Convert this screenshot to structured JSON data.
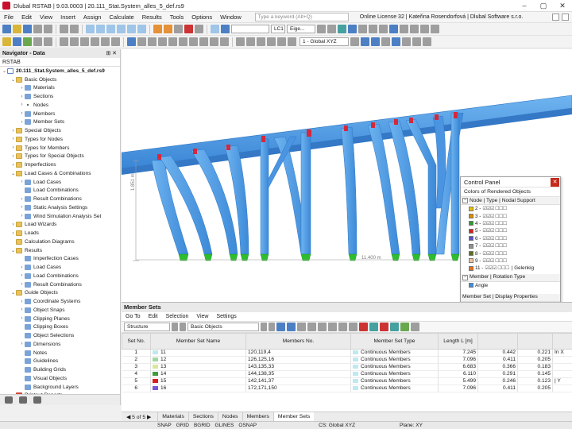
{
  "window": {
    "title": "Dlubal RSTAB | 9.03.0003 | 20.111_Stat.System_alles_5_def.rs9"
  },
  "menu": {
    "items": [
      "File",
      "Edit",
      "View",
      "Insert",
      "Assign",
      "Calculate",
      "Results",
      "Tools",
      "Options",
      "Window"
    ],
    "search_placeholder": "Type a keyword (Alt+Q)",
    "license": "Online License 32 | Kateřina Rosendorfová | Dlubal Software s.r.o."
  },
  "toolbar": {
    "load_case": "LC1",
    "load_case_name": "Eige...",
    "coordinate_system": "1 - Global XYZ"
  },
  "navigator": {
    "title": "Navigator - Data",
    "tab": "RSTAB",
    "tree": [
      {
        "label": "20.111_Stat.System_alles_5_def.rs9",
        "level": 0,
        "icon": "file",
        "bold": true,
        "toggle": "v"
      },
      {
        "label": "Basic Objects",
        "level": 1,
        "icon": "folder",
        "toggle": "v"
      },
      {
        "label": "Materials",
        "level": 2,
        "icon": "item",
        "toggle": ">"
      },
      {
        "label": "Sections",
        "level": 2,
        "icon": "item",
        "toggle": ">"
      },
      {
        "label": "Nodes",
        "level": 2,
        "icon": "dot",
        "toggle": ">"
      },
      {
        "label": "Members",
        "level": 2,
        "icon": "item",
        "toggle": ">"
      },
      {
        "label": "Member Sets",
        "level": 2,
        "icon": "item",
        "toggle": ">"
      },
      {
        "label": "Special Objects",
        "level": 1,
        "icon": "folder",
        "toggle": ">"
      },
      {
        "label": "Types for Nodes",
        "level": 1,
        "icon": "folder",
        "toggle": ">"
      },
      {
        "label": "Types for Members",
        "level": 1,
        "icon": "folder",
        "toggle": ">"
      },
      {
        "label": "Types for Special Objects",
        "level": 1,
        "icon": "folder",
        "toggle": ">"
      },
      {
        "label": "Imperfections",
        "level": 1,
        "icon": "folder",
        "toggle": ">"
      },
      {
        "label": "Load Cases & Combinations",
        "level": 1,
        "icon": "folder",
        "toggle": "v"
      },
      {
        "label": "Load Cases",
        "level": 2,
        "icon": "item",
        "toggle": ">"
      },
      {
        "label": "Load Combinations",
        "level": 2,
        "icon": "item",
        "toggle": ""
      },
      {
        "label": "Result Combinations",
        "level": 2,
        "icon": "item",
        "toggle": ">"
      },
      {
        "label": "Static Analysis Settings",
        "level": 2,
        "icon": "item",
        "toggle": ">"
      },
      {
        "label": "Wind Simulation Analysis Set",
        "level": 2,
        "icon": "item",
        "toggle": ">"
      },
      {
        "label": "Load Wizards",
        "level": 1,
        "icon": "folder",
        "toggle": ">"
      },
      {
        "label": "Loads",
        "level": 1,
        "icon": "folder",
        "toggle": ">"
      },
      {
        "label": "Calculation Diagrams",
        "level": 1,
        "icon": "folder",
        "toggle": ""
      },
      {
        "label": "Results",
        "level": 1,
        "icon": "folder",
        "toggle": "v"
      },
      {
        "label": "Imperfection Cases",
        "level": 2,
        "icon": "item",
        "toggle": ""
      },
      {
        "label": "Load Cases",
        "level": 2,
        "icon": "item",
        "toggle": ">"
      },
      {
        "label": "Load Combinations",
        "level": 2,
        "icon": "item",
        "toggle": ">"
      },
      {
        "label": "Result Combinations",
        "level": 2,
        "icon": "item",
        "toggle": ">"
      },
      {
        "label": "Guide Objects",
        "level": 1,
        "icon": "folder",
        "toggle": "v"
      },
      {
        "label": "Coordinate Systems",
        "level": 2,
        "icon": "item",
        "toggle": ">"
      },
      {
        "label": "Object Snaps",
        "level": 2,
        "icon": "item",
        "toggle": ">"
      },
      {
        "label": "Clipping Planes",
        "level": 2,
        "icon": "item",
        "toggle": ">"
      },
      {
        "label": "Clipping Boxes",
        "level": 2,
        "icon": "item",
        "toggle": ""
      },
      {
        "label": "Object Selections",
        "level": 2,
        "icon": "item",
        "toggle": ""
      },
      {
        "label": "Dimensions",
        "level": 2,
        "icon": "item",
        "toggle": ">"
      },
      {
        "label": "Notes",
        "level": 2,
        "icon": "item",
        "toggle": ""
      },
      {
        "label": "Guidelines",
        "level": 2,
        "icon": "item",
        "toggle": ""
      },
      {
        "label": "Building Grids",
        "level": 2,
        "icon": "item",
        "toggle": ""
      },
      {
        "label": "Visual Objects",
        "level": 2,
        "icon": "item",
        "toggle": ""
      },
      {
        "label": "Background Layers",
        "level": 2,
        "icon": "item",
        "toggle": ""
      },
      {
        "label": "Printout Reports",
        "level": 1,
        "icon": "red",
        "toggle": ">"
      }
    ]
  },
  "viewport": {
    "dim_vertical": "1.851 m",
    "dim_horizontal": "11.400 m"
  },
  "control_panel": {
    "title": "Control Panel",
    "subtitle": "Colors of Rendered Objects",
    "section_support": "Node | Type | Nodal Support",
    "supports": [
      {
        "label": "2 -",
        "color": "#e8c000"
      },
      {
        "label": "3 -",
        "color": "#e08a00"
      },
      {
        "label": "4 -",
        "color": "#2e9b2e"
      },
      {
        "label": "5 -",
        "color": "#d21f1f"
      },
      {
        "label": "6 -",
        "color": "#5a4fc8"
      },
      {
        "label": "7 -",
        "color": "#909090"
      },
      {
        "label": "8 -",
        "color": "#5a6e1e"
      },
      {
        "label": "9 -",
        "color": "#f0c3a0"
      },
      {
        "label": "11 -",
        "color": "#e07020",
        "suffix": "| Gelenkig"
      }
    ],
    "section_rotation": "Member | Rotation Type",
    "rotation_label": "Angle",
    "rotation_color": "#3a8fe0",
    "section_display": "Member Set | Display Properties"
  },
  "member_sets": {
    "title": "Member Sets",
    "menu": [
      "Go To",
      "Edit",
      "Selection",
      "View",
      "Settings"
    ],
    "structure_combo": "Structure",
    "objects_combo": "Basic Objects",
    "columns": [
      "Set No.",
      "Member Set Name",
      "Members No.",
      "Member Set Type",
      "Length L [m]",
      "",
      "",
      ""
    ],
    "rows": [
      {
        "no": "1",
        "name": "11",
        "members": "120,119,4",
        "type": "Continuous Members",
        "length": "7.245",
        "c6": "0.442",
        "c7": "0.221",
        "c8": "In X",
        "color": "#bfe8f0"
      },
      {
        "no": "2",
        "name": "12",
        "members": "126,125,16",
        "type": "Continuous Members",
        "length": "7.096",
        "c6": "0.411",
        "c7": "0.205",
        "c8": "",
        "color": "#9fd89f"
      },
      {
        "no": "3",
        "name": "13",
        "members": "143,135,33",
        "type": "Continuous Members",
        "length": "6.683",
        "c6": "0.366",
        "c7": "0.183",
        "c8": "",
        "color": "#d7e89a"
      },
      {
        "no": "4",
        "name": "14",
        "members": "144,138,35",
        "type": "Continuous Members",
        "length": "6.110",
        "c6": "0.291",
        "c7": "0.145",
        "c8": "",
        "color": "#3e9e3e"
      },
      {
        "no": "5",
        "name": "15",
        "members": "142,141,37",
        "type": "Continuous Members",
        "length": "5.499",
        "c6": "0.246",
        "c7": "0.123",
        "c8": "| Y",
        "color": "#d92020"
      },
      {
        "no": "6",
        "name": "16",
        "members": "172,171,150",
        "type": "Continuous Members",
        "length": "7.096",
        "c6": "0.411",
        "c7": "0.205",
        "c8": "",
        "color": "#7a5ad0"
      }
    ],
    "pager": "5 of 5",
    "tabs": [
      "Materials",
      "Sections",
      "Nodes",
      "Members",
      "Member Sets"
    ],
    "active_tab": "Member Sets"
  },
  "statusbar": {
    "items": [
      "SNAP",
      "GRID",
      "BGRID",
      "GLINES",
      "OSNAP"
    ],
    "cs": "CS: Global XYZ",
    "plane": "Plane: XY"
  },
  "colors": {
    "member_blue": "#4a9ae6",
    "member_dark": "#2f78c4",
    "support_green": "#2ebd2e",
    "hinge_red": "#d6283a"
  }
}
